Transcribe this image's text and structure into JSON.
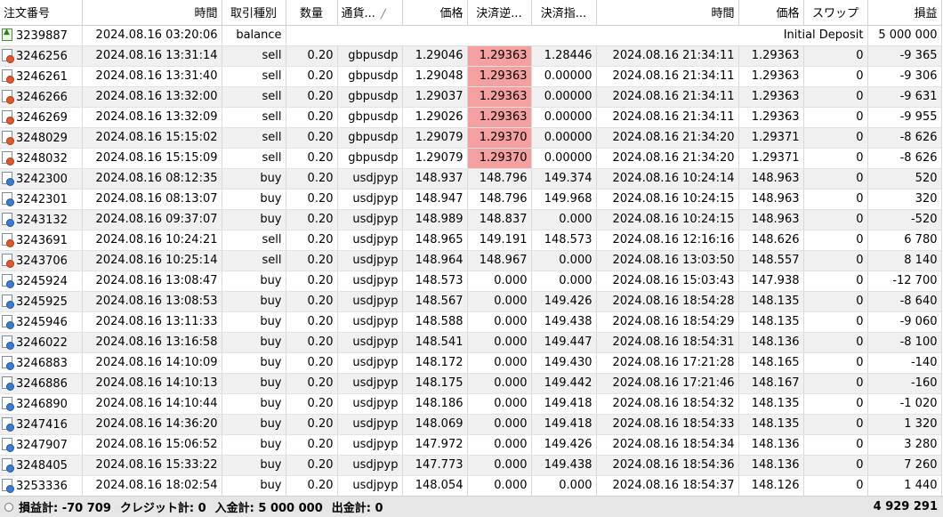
{
  "columns": [
    "注文番号",
    "時間",
    "取引種別",
    "数量",
    "通貨...",
    "価格",
    "決済逆...",
    "決済指...",
    "時間",
    "価格",
    "スワップ",
    "損益"
  ],
  "balance_row": {
    "id": "3239887",
    "time": "2024.08.16 03:20:06",
    "type": "balance",
    "comment": "Initial Deposit",
    "profit": "5 000 000"
  },
  "rows": [
    {
      "id": "3246256",
      "time": "2024.08.16 13:31:14",
      "type": "sell",
      "vol": "0.20",
      "sym": "gbpusdp",
      "price": "1.29046",
      "sl": "1.29363",
      "tp": "1.28446",
      "ctime": "2024.08.16 21:34:11",
      "cprice": "1.29363",
      "swap": "0",
      "profit": "-9 365",
      "hl": true
    },
    {
      "id": "3246261",
      "time": "2024.08.16 13:31:40",
      "type": "sell",
      "vol": "0.20",
      "sym": "gbpusdp",
      "price": "1.29048",
      "sl": "1.29363",
      "tp": "0.00000",
      "ctime": "2024.08.16 21:34:11",
      "cprice": "1.29363",
      "swap": "0",
      "profit": "-9 306",
      "hl": true
    },
    {
      "id": "3246266",
      "time": "2024.08.16 13:32:00",
      "type": "sell",
      "vol": "0.20",
      "sym": "gbpusdp",
      "price": "1.29037",
      "sl": "1.29363",
      "tp": "0.00000",
      "ctime": "2024.08.16 21:34:11",
      "cprice": "1.29363",
      "swap": "0",
      "profit": "-9 631",
      "hl": true
    },
    {
      "id": "3246269",
      "time": "2024.08.16 13:32:09",
      "type": "sell",
      "vol": "0.20",
      "sym": "gbpusdp",
      "price": "1.29026",
      "sl": "1.29363",
      "tp": "0.00000",
      "ctime": "2024.08.16 21:34:11",
      "cprice": "1.29363",
      "swap": "0",
      "profit": "-9 955",
      "hl": true
    },
    {
      "id": "3248029",
      "time": "2024.08.16 15:15:02",
      "type": "sell",
      "vol": "0.20",
      "sym": "gbpusdp",
      "price": "1.29079",
      "sl": "1.29370",
      "tp": "0.00000",
      "ctime": "2024.08.16 21:34:20",
      "cprice": "1.29371",
      "swap": "0",
      "profit": "-8 626",
      "hl": true
    },
    {
      "id": "3248032",
      "time": "2024.08.16 15:15:09",
      "type": "sell",
      "vol": "0.20",
      "sym": "gbpusdp",
      "price": "1.29079",
      "sl": "1.29370",
      "tp": "0.00000",
      "ctime": "2024.08.16 21:34:20",
      "cprice": "1.29371",
      "swap": "0",
      "profit": "-8 626",
      "hl": true
    },
    {
      "id": "3242300",
      "time": "2024.08.16 08:12:35",
      "type": "buy",
      "vol": "0.20",
      "sym": "usdjpyp",
      "price": "148.937",
      "sl": "148.796",
      "tp": "149.374",
      "ctime": "2024.08.16 10:24:14",
      "cprice": "148.963",
      "swap": "0",
      "profit": "520",
      "hl": false
    },
    {
      "id": "3242301",
      "time": "2024.08.16 08:13:07",
      "type": "buy",
      "vol": "0.20",
      "sym": "usdjpyp",
      "price": "148.947",
      "sl": "148.796",
      "tp": "149.968",
      "ctime": "2024.08.16 10:24:15",
      "cprice": "148.963",
      "swap": "0",
      "profit": "320",
      "hl": false
    },
    {
      "id": "3243132",
      "time": "2024.08.16 09:37:07",
      "type": "buy",
      "vol": "0.20",
      "sym": "usdjpyp",
      "price": "148.989",
      "sl": "148.837",
      "tp": "0.000",
      "ctime": "2024.08.16 10:24:15",
      "cprice": "148.963",
      "swap": "0",
      "profit": "-520",
      "hl": false
    },
    {
      "id": "3243691",
      "time": "2024.08.16 10:24:21",
      "type": "sell",
      "vol": "0.20",
      "sym": "usdjpyp",
      "price": "148.965",
      "sl": "149.191",
      "tp": "148.573",
      "ctime": "2024.08.16 12:16:16",
      "cprice": "148.626",
      "swap": "0",
      "profit": "6 780",
      "hl": false
    },
    {
      "id": "3243706",
      "time": "2024.08.16 10:25:14",
      "type": "sell",
      "vol": "0.20",
      "sym": "usdjpyp",
      "price": "148.964",
      "sl": "148.967",
      "tp": "0.000",
      "ctime": "2024.08.16 13:03:50",
      "cprice": "148.557",
      "swap": "0",
      "profit": "8 140",
      "hl": false
    },
    {
      "id": "3245924",
      "time": "2024.08.16 13:08:47",
      "type": "buy",
      "vol": "0.20",
      "sym": "usdjpyp",
      "price": "148.573",
      "sl": "0.000",
      "tp": "0.000",
      "ctime": "2024.08.16 15:03:43",
      "cprice": "147.938",
      "swap": "0",
      "profit": "-12 700",
      "hl": false
    },
    {
      "id": "3245925",
      "time": "2024.08.16 13:08:53",
      "type": "buy",
      "vol": "0.20",
      "sym": "usdjpyp",
      "price": "148.567",
      "sl": "0.000",
      "tp": "149.426",
      "ctime": "2024.08.16 18:54:28",
      "cprice": "148.135",
      "swap": "0",
      "profit": "-8 640",
      "hl": false
    },
    {
      "id": "3245946",
      "time": "2024.08.16 13:11:33",
      "type": "buy",
      "vol": "0.20",
      "sym": "usdjpyp",
      "price": "148.588",
      "sl": "0.000",
      "tp": "149.438",
      "ctime": "2024.08.16 18:54:29",
      "cprice": "148.135",
      "swap": "0",
      "profit": "-9 060",
      "hl": false
    },
    {
      "id": "3246022",
      "time": "2024.08.16 13:16:58",
      "type": "buy",
      "vol": "0.20",
      "sym": "usdjpyp",
      "price": "148.541",
      "sl": "0.000",
      "tp": "149.447",
      "ctime": "2024.08.16 18:54:31",
      "cprice": "148.136",
      "swap": "0",
      "profit": "-8 100",
      "hl": false
    },
    {
      "id": "3246883",
      "time": "2024.08.16 14:10:09",
      "type": "buy",
      "vol": "0.20",
      "sym": "usdjpyp",
      "price": "148.172",
      "sl": "0.000",
      "tp": "149.430",
      "ctime": "2024.08.16 17:21:28",
      "cprice": "148.165",
      "swap": "0",
      "profit": "-140",
      "hl": false
    },
    {
      "id": "3246886",
      "time": "2024.08.16 14:10:13",
      "type": "buy",
      "vol": "0.20",
      "sym": "usdjpyp",
      "price": "148.175",
      "sl": "0.000",
      "tp": "149.442",
      "ctime": "2024.08.16 17:21:46",
      "cprice": "148.167",
      "swap": "0",
      "profit": "-160",
      "hl": false
    },
    {
      "id": "3246890",
      "time": "2024.08.16 14:10:44",
      "type": "buy",
      "vol": "0.20",
      "sym": "usdjpyp",
      "price": "148.186",
      "sl": "0.000",
      "tp": "149.418",
      "ctime": "2024.08.16 18:54:32",
      "cprice": "148.135",
      "swap": "0",
      "profit": "-1 020",
      "hl": false
    },
    {
      "id": "3247416",
      "time": "2024.08.16 14:36:20",
      "type": "buy",
      "vol": "0.20",
      "sym": "usdjpyp",
      "price": "148.069",
      "sl": "0.000",
      "tp": "149.418",
      "ctime": "2024.08.16 18:54:33",
      "cprice": "148.135",
      "swap": "0",
      "profit": "1 320",
      "hl": false
    },
    {
      "id": "3247907",
      "time": "2024.08.16 15:06:52",
      "type": "buy",
      "vol": "0.20",
      "sym": "usdjpyp",
      "price": "147.972",
      "sl": "0.000",
      "tp": "149.426",
      "ctime": "2024.08.16 18:54:34",
      "cprice": "148.136",
      "swap": "0",
      "profit": "3 280",
      "hl": false
    },
    {
      "id": "3248405",
      "time": "2024.08.16 15:33:22",
      "type": "buy",
      "vol": "0.20",
      "sym": "usdjpyp",
      "price": "147.773",
      "sl": "0.000",
      "tp": "149.438",
      "ctime": "2024.08.16 18:54:36",
      "cprice": "148.136",
      "swap": "0",
      "profit": "7 260",
      "hl": false
    },
    {
      "id": "3253336",
      "time": "2024.08.16 18:02:54",
      "type": "buy",
      "vol": "0.20",
      "sym": "usdjpyp",
      "price": "148.054",
      "sl": "0.000",
      "tp": "0.000",
      "ctime": "2024.08.16 18:54:37",
      "cprice": "148.126",
      "swap": "0",
      "profit": "1 440",
      "hl": false
    }
  ],
  "footer": {
    "profit": "損益計: -70 709",
    "credit": "クレジット計: 0",
    "deposit": "入金計: 5 000 000",
    "withdrawal": "出金計: 0",
    "total": "4 929 291"
  },
  "colors": {
    "highlight": "#f4a0a0",
    "alt_row": "#f0f0f0",
    "footer_bg": "#e6e6e6"
  }
}
